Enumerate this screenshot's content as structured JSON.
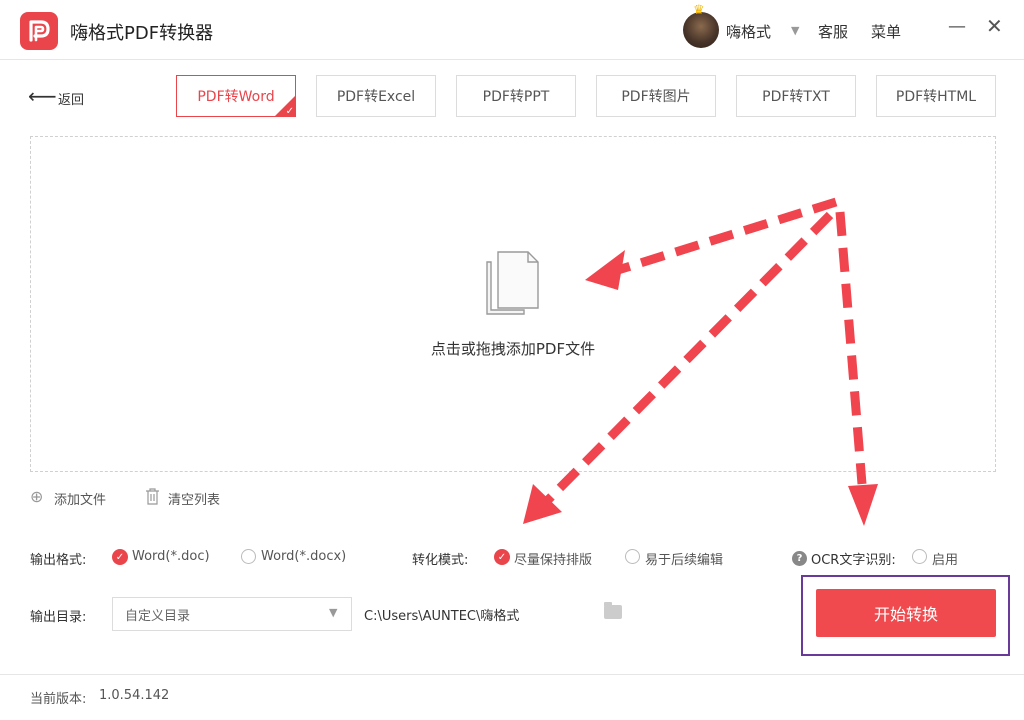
{
  "window": {
    "title": "嗨格式PDF转换器",
    "user_name": "嗨格式",
    "service_label": "客服",
    "menu_label": "菜单",
    "minimize_glyph": "—",
    "close_glyph": "✕"
  },
  "nav": {
    "back_label": "返回",
    "tabs": [
      {
        "label": "PDF转Word",
        "active": true
      },
      {
        "label": "PDF转Excel",
        "active": false
      },
      {
        "label": "PDF转PPT",
        "active": false
      },
      {
        "label": "PDF转图片",
        "active": false
      },
      {
        "label": "PDF转TXT",
        "active": false
      },
      {
        "label": "PDF转HTML",
        "active": false
      }
    ]
  },
  "dropzone": {
    "hint": "点击或拖拽添加PDF文件",
    "icon": "document-stack-icon"
  },
  "file_actions": {
    "add_files": "添加文件",
    "clear_list": "清空列表"
  },
  "options": {
    "format_label": "输出格式:",
    "format_options": [
      {
        "label": "Word(*.doc)",
        "selected": true
      },
      {
        "label": "Word(*.docx)",
        "selected": false
      }
    ],
    "mode_label": "转化模式:",
    "mode_options": [
      {
        "label": "尽量保持排版",
        "selected": true
      },
      {
        "label": "易于后续编辑",
        "selected": false
      }
    ],
    "ocr_label": "OCR文字识别:",
    "ocr_enable": "启用",
    "ocr_enabled": false
  },
  "output": {
    "dir_label": "输出目录:",
    "dir_select_value": "自定义目录",
    "path": "C:\\Users\\AUNTEC\\嗨格式",
    "start_button": "开始转换"
  },
  "footer": {
    "version_label": "当前版本:",
    "version_value": "1.0.54.142"
  },
  "colors": {
    "accent": "#e9454b",
    "button": "#f04a4e",
    "arrow": "#f0444e",
    "highlight_box": "#6a3a9a"
  }
}
